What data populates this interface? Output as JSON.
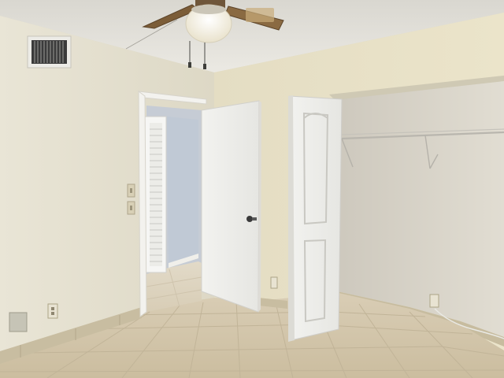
{
  "photo": {
    "subject": "empty-bedroom",
    "colors": {
      "ceiling": "#e9e7e1",
      "left_wall": "#e6e2d2",
      "back_wall": "#e3dcc3",
      "closet_interior": "#d6d1c6",
      "hall_wall": "#c3cbd6",
      "floor_tile": "#d2c5ac",
      "grout": "#bfb297",
      "baseboard": "#c9bea2",
      "door": "#f4f4f2",
      "fan_blade": "#8a6a42",
      "fan_light": "#f7f3e6"
    },
    "icons": [
      "ceiling-fan-icon",
      "air-vent-icon",
      "light-switch-icon",
      "power-outlet-icon",
      "door-knob-icon",
      "closet-rod-icon"
    ]
  }
}
